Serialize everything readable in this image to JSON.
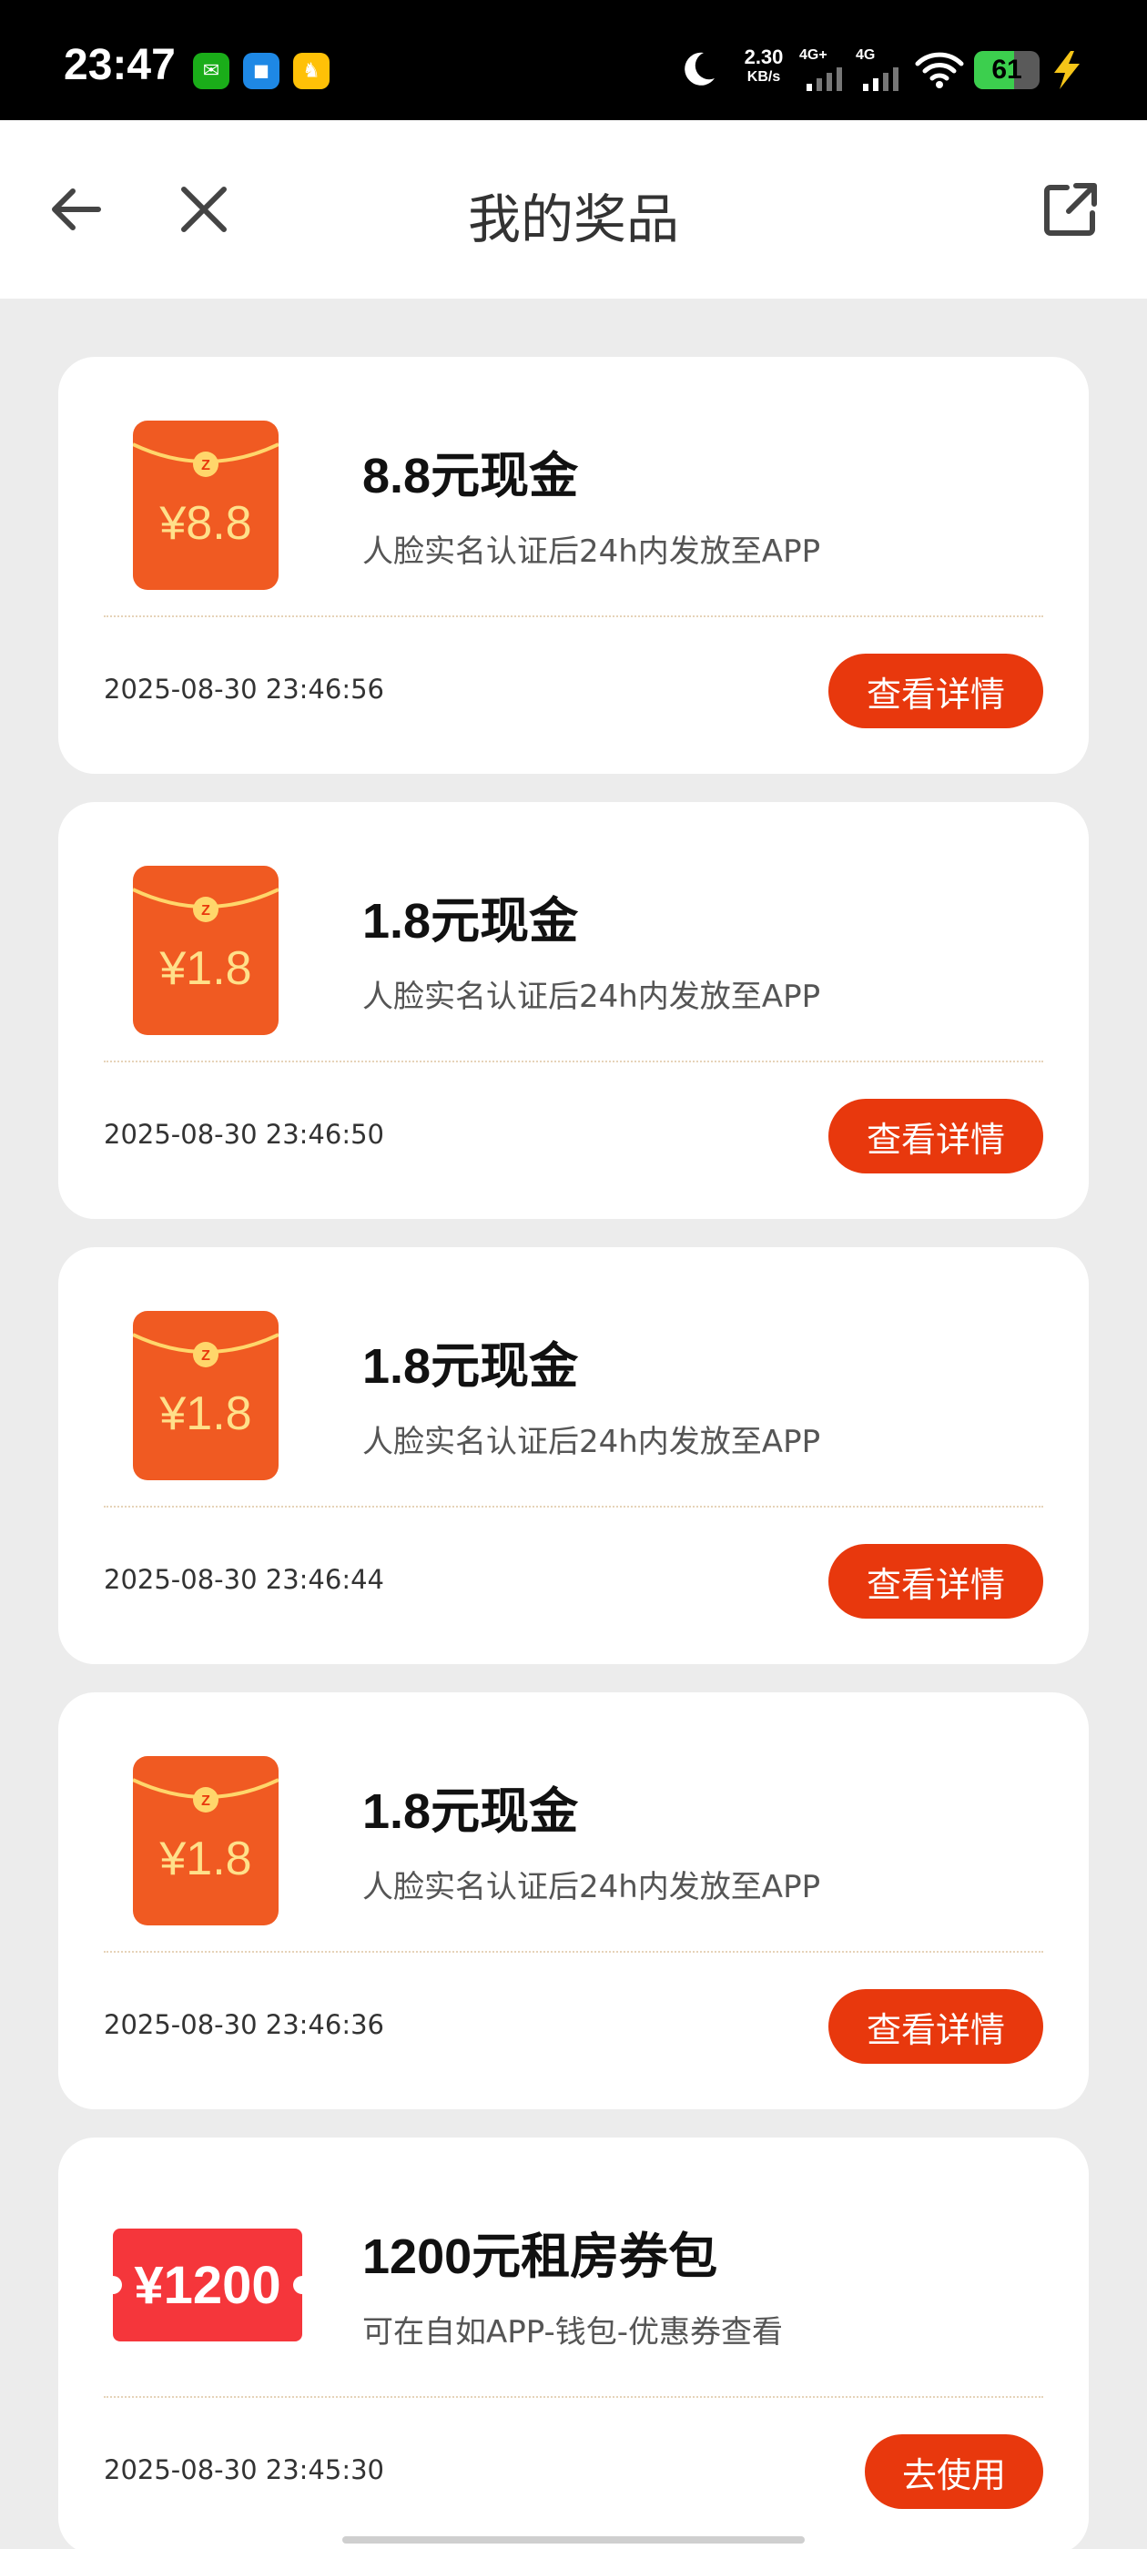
{
  "status_bar": {
    "time": "23:47",
    "net_speed_value": "2.30",
    "net_speed_unit": "KB/s",
    "sim1_label": "4G+",
    "sim2_label": "4G",
    "battery_level": "61",
    "battery_fraction": 0.61,
    "app_icons": [
      "wechat-icon",
      "blue-app-icon",
      "yellow-app-icon"
    ]
  },
  "header": {
    "title": "我的奖品",
    "icons": {
      "back": "back-arrow-icon",
      "close": "close-icon",
      "share": "share-external-icon"
    }
  },
  "colors": {
    "accent": "#e8380d",
    "envelope": "#f05a22",
    "coupon": "#f5363b",
    "gold": "#ffd66b",
    "background": "#ececec"
  },
  "prizes": [
    {
      "amount": "¥8.8",
      "title": "8.8元现金",
      "desc": "人脸实名认证后24h内发放至APP",
      "time": "2025-08-30 23:46:56",
      "button": "查看详情"
    },
    {
      "amount": "¥1.8",
      "title": "1.8元现金",
      "desc": "人脸实名认证后24h内发放至APP",
      "time": "2025-08-30 23:46:50",
      "button": "查看详情"
    },
    {
      "amount": "¥1.8",
      "title": "1.8元现金",
      "desc": "人脸实名认证后24h内发放至APP",
      "time": "2025-08-30 23:46:44",
      "button": "查看详情"
    },
    {
      "amount": "¥1.8",
      "title": "1.8元现金",
      "desc": "人脸实名认证后24h内发放至APP",
      "time": "2025-08-30 23:46:36",
      "button": "查看详情"
    },
    {
      "amount": "¥1200",
      "title": "1200元租房券包",
      "desc": "可在自如APP-钱包-优惠券查看",
      "time": "2025-08-30 23:45:30",
      "button": "去使用"
    }
  ]
}
